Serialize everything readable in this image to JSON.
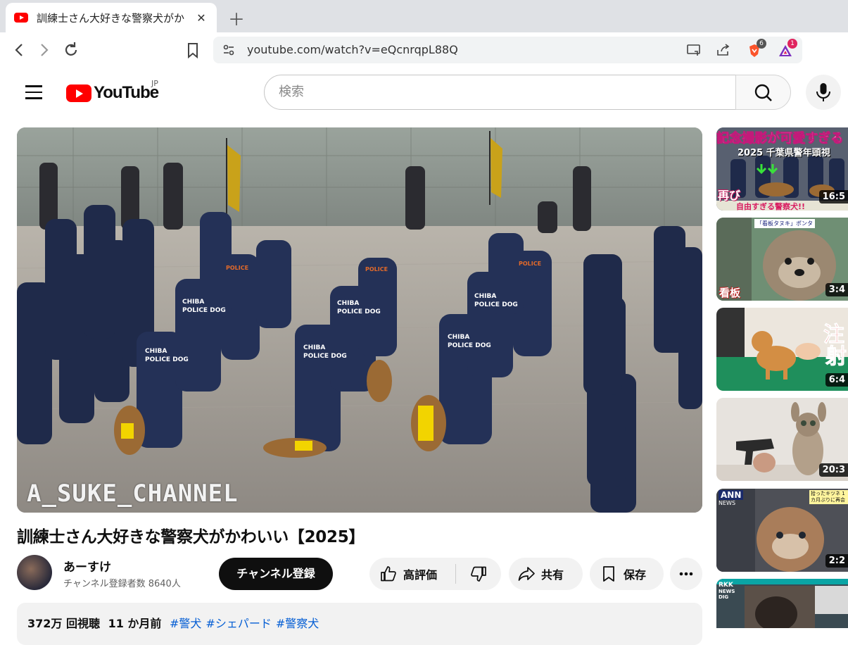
{
  "browser": {
    "tab_title": "訓練士さん大好きな警察犬がかわいい",
    "tab_close": "✕",
    "new_tab": "＋",
    "url": "youtube.com/watch?v=eQcnrqpL88Q",
    "brave_badge": "6",
    "rewards_badge": "1"
  },
  "youtube": {
    "logo_text": "YouTube",
    "region": "JP",
    "search_placeholder": "検索"
  },
  "video": {
    "watermark": "A_SUKE_CHANNEL",
    "title": "訓練士さん大好きな警察犬がかわいい【2025】",
    "channel_name": "あーすけ",
    "subscribers": "チャンネル登録者数 8640人",
    "subscribe_label": "チャンネル登録",
    "like_label": "高評価",
    "share_label": "共有",
    "save_label": "保存",
    "views": "372万 回視聴",
    "age": "11 か月前",
    "hashtags": [
      "#警犬",
      "#シェパード",
      "#警察犬"
    ]
  },
  "sidebar": [
    {
      "overlay_top": "記念撮影が可愛すぎる",
      "overlay_mid": "2025 千葉県警年頭視",
      "overlay_bottom": "再び",
      "overlay_caption": "自由すぎる警察犬!!",
      "duration": "16:5"
    },
    {
      "overlay_tag": "「看板タヌキ」ポンタ",
      "overlay_bottom": "看板",
      "duration": "3:4"
    },
    {
      "overlay_big": "注",
      "overlay_big2": "射",
      "duration": "6:4"
    },
    {
      "duration": "20:3"
    },
    {
      "channel_logo": "ANN",
      "channel_sub": "NEWS",
      "overlay_tag": "拾ったキツネ 1カ月ぶりに再会",
      "duration": "2:2"
    },
    {
      "channel_logo": "RKK",
      "channel_sub": "NEWS DIG"
    }
  ],
  "colors": {
    "accent_red": "#ff0000",
    "link_blue": "#065fd4",
    "uniform_navy": "#1f2a4a"
  }
}
